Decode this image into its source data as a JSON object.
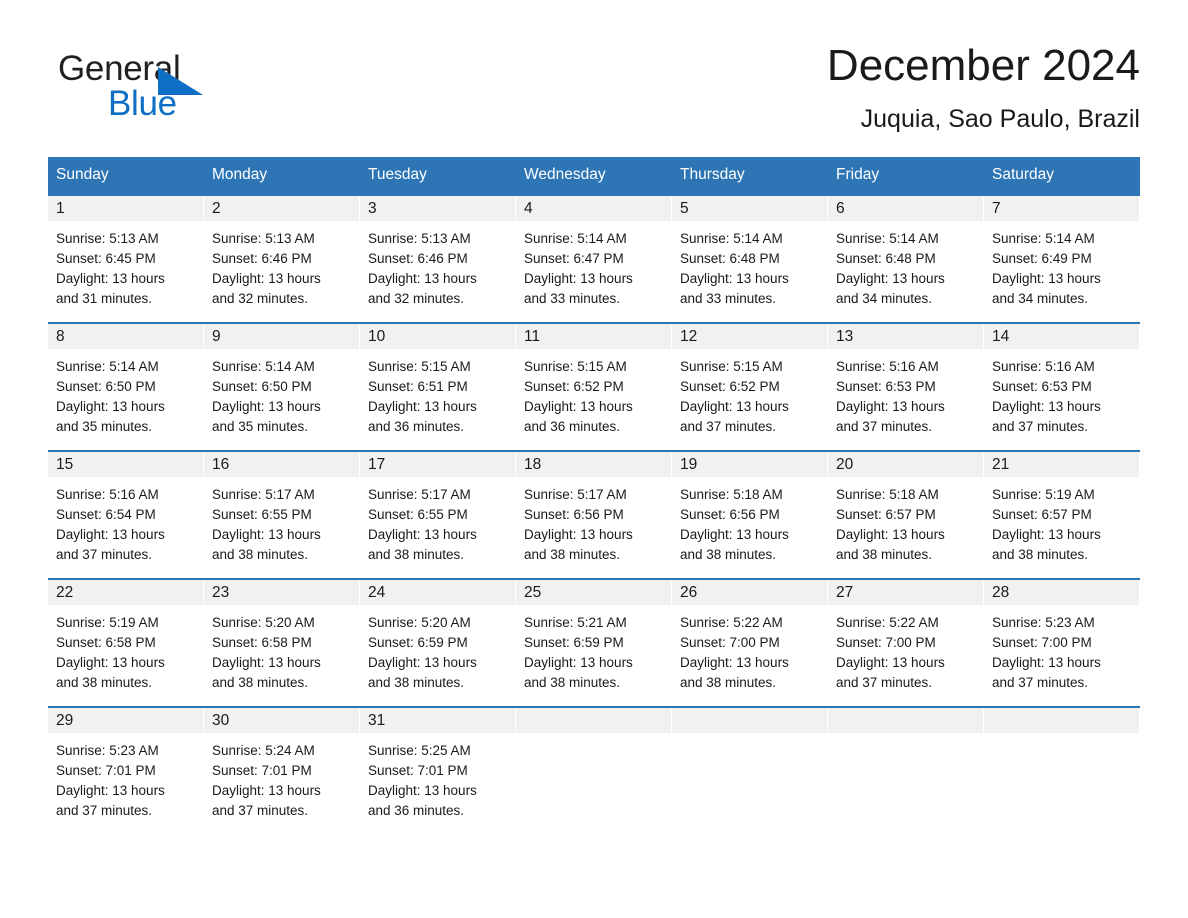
{
  "brand": {
    "name_part1": "General",
    "name_part2": "Blue",
    "triangle_color": "#0f6fc5"
  },
  "header": {
    "title": "December 2024",
    "subtitle": "Juquia, Sao Paulo, Brazil"
  },
  "theme": {
    "header_blue": "#2e75b6",
    "day_band_gray": "#f1f1f1",
    "text_color": "#1a1a1a"
  },
  "weekdays": [
    "Sunday",
    "Monday",
    "Tuesday",
    "Wednesday",
    "Thursday",
    "Friday",
    "Saturday"
  ],
  "weeks": [
    [
      {
        "day": "1",
        "sunrise": "Sunrise: 5:13 AM",
        "sunset": "Sunset: 6:45 PM",
        "daylight1": "Daylight: 13 hours",
        "daylight2": "and 31 minutes."
      },
      {
        "day": "2",
        "sunrise": "Sunrise: 5:13 AM",
        "sunset": "Sunset: 6:46 PM",
        "daylight1": "Daylight: 13 hours",
        "daylight2": "and 32 minutes."
      },
      {
        "day": "3",
        "sunrise": "Sunrise: 5:13 AM",
        "sunset": "Sunset: 6:46 PM",
        "daylight1": "Daylight: 13 hours",
        "daylight2": "and 32 minutes."
      },
      {
        "day": "4",
        "sunrise": "Sunrise: 5:14 AM",
        "sunset": "Sunset: 6:47 PM",
        "daylight1": "Daylight: 13 hours",
        "daylight2": "and 33 minutes."
      },
      {
        "day": "5",
        "sunrise": "Sunrise: 5:14 AM",
        "sunset": "Sunset: 6:48 PM",
        "daylight1": "Daylight: 13 hours",
        "daylight2": "and 33 minutes."
      },
      {
        "day": "6",
        "sunrise": "Sunrise: 5:14 AM",
        "sunset": "Sunset: 6:48 PM",
        "daylight1": "Daylight: 13 hours",
        "daylight2": "and 34 minutes."
      },
      {
        "day": "7",
        "sunrise": "Sunrise: 5:14 AM",
        "sunset": "Sunset: 6:49 PM",
        "daylight1": "Daylight: 13 hours",
        "daylight2": "and 34 minutes."
      }
    ],
    [
      {
        "day": "8",
        "sunrise": "Sunrise: 5:14 AM",
        "sunset": "Sunset: 6:50 PM",
        "daylight1": "Daylight: 13 hours",
        "daylight2": "and 35 minutes."
      },
      {
        "day": "9",
        "sunrise": "Sunrise: 5:14 AM",
        "sunset": "Sunset: 6:50 PM",
        "daylight1": "Daylight: 13 hours",
        "daylight2": "and 35 minutes."
      },
      {
        "day": "10",
        "sunrise": "Sunrise: 5:15 AM",
        "sunset": "Sunset: 6:51 PM",
        "daylight1": "Daylight: 13 hours",
        "daylight2": "and 36 minutes."
      },
      {
        "day": "11",
        "sunrise": "Sunrise: 5:15 AM",
        "sunset": "Sunset: 6:52 PM",
        "daylight1": "Daylight: 13 hours",
        "daylight2": "and 36 minutes."
      },
      {
        "day": "12",
        "sunrise": "Sunrise: 5:15 AM",
        "sunset": "Sunset: 6:52 PM",
        "daylight1": "Daylight: 13 hours",
        "daylight2": "and 37 minutes."
      },
      {
        "day": "13",
        "sunrise": "Sunrise: 5:16 AM",
        "sunset": "Sunset: 6:53 PM",
        "daylight1": "Daylight: 13 hours",
        "daylight2": "and 37 minutes."
      },
      {
        "day": "14",
        "sunrise": "Sunrise: 5:16 AM",
        "sunset": "Sunset: 6:53 PM",
        "daylight1": "Daylight: 13 hours",
        "daylight2": "and 37 minutes."
      }
    ],
    [
      {
        "day": "15",
        "sunrise": "Sunrise: 5:16 AM",
        "sunset": "Sunset: 6:54 PM",
        "daylight1": "Daylight: 13 hours",
        "daylight2": "and 37 minutes."
      },
      {
        "day": "16",
        "sunrise": "Sunrise: 5:17 AM",
        "sunset": "Sunset: 6:55 PM",
        "daylight1": "Daylight: 13 hours",
        "daylight2": "and 38 minutes."
      },
      {
        "day": "17",
        "sunrise": "Sunrise: 5:17 AM",
        "sunset": "Sunset: 6:55 PM",
        "daylight1": "Daylight: 13 hours",
        "daylight2": "and 38 minutes."
      },
      {
        "day": "18",
        "sunrise": "Sunrise: 5:17 AM",
        "sunset": "Sunset: 6:56 PM",
        "daylight1": "Daylight: 13 hours",
        "daylight2": "and 38 minutes."
      },
      {
        "day": "19",
        "sunrise": "Sunrise: 5:18 AM",
        "sunset": "Sunset: 6:56 PM",
        "daylight1": "Daylight: 13 hours",
        "daylight2": "and 38 minutes."
      },
      {
        "day": "20",
        "sunrise": "Sunrise: 5:18 AM",
        "sunset": "Sunset: 6:57 PM",
        "daylight1": "Daylight: 13 hours",
        "daylight2": "and 38 minutes."
      },
      {
        "day": "21",
        "sunrise": "Sunrise: 5:19 AM",
        "sunset": "Sunset: 6:57 PM",
        "daylight1": "Daylight: 13 hours",
        "daylight2": "and 38 minutes."
      }
    ],
    [
      {
        "day": "22",
        "sunrise": "Sunrise: 5:19 AM",
        "sunset": "Sunset: 6:58 PM",
        "daylight1": "Daylight: 13 hours",
        "daylight2": "and 38 minutes."
      },
      {
        "day": "23",
        "sunrise": "Sunrise: 5:20 AM",
        "sunset": "Sunset: 6:58 PM",
        "daylight1": "Daylight: 13 hours",
        "daylight2": "and 38 minutes."
      },
      {
        "day": "24",
        "sunrise": "Sunrise: 5:20 AM",
        "sunset": "Sunset: 6:59 PM",
        "daylight1": "Daylight: 13 hours",
        "daylight2": "and 38 minutes."
      },
      {
        "day": "25",
        "sunrise": "Sunrise: 5:21 AM",
        "sunset": "Sunset: 6:59 PM",
        "daylight1": "Daylight: 13 hours",
        "daylight2": "and 38 minutes."
      },
      {
        "day": "26",
        "sunrise": "Sunrise: 5:22 AM",
        "sunset": "Sunset: 7:00 PM",
        "daylight1": "Daylight: 13 hours",
        "daylight2": "and 38 minutes."
      },
      {
        "day": "27",
        "sunrise": "Sunrise: 5:22 AM",
        "sunset": "Sunset: 7:00 PM",
        "daylight1": "Daylight: 13 hours",
        "daylight2": "and 37 minutes."
      },
      {
        "day": "28",
        "sunrise": "Sunrise: 5:23 AM",
        "sunset": "Sunset: 7:00 PM",
        "daylight1": "Daylight: 13 hours",
        "daylight2": "and 37 minutes."
      }
    ],
    [
      {
        "day": "29",
        "sunrise": "Sunrise: 5:23 AM",
        "sunset": "Sunset: 7:01 PM",
        "daylight1": "Daylight: 13 hours",
        "daylight2": "and 37 minutes."
      },
      {
        "day": "30",
        "sunrise": "Sunrise: 5:24 AM",
        "sunset": "Sunset: 7:01 PM",
        "daylight1": "Daylight: 13 hours",
        "daylight2": "and 37 minutes."
      },
      {
        "day": "31",
        "sunrise": "Sunrise: 5:25 AM",
        "sunset": "Sunset: 7:01 PM",
        "daylight1": "Daylight: 13 hours",
        "daylight2": "and 36 minutes."
      },
      {
        "day": "",
        "sunrise": "",
        "sunset": "",
        "daylight1": "",
        "daylight2": ""
      },
      {
        "day": "",
        "sunrise": "",
        "sunset": "",
        "daylight1": "",
        "daylight2": ""
      },
      {
        "day": "",
        "sunrise": "",
        "sunset": "",
        "daylight1": "",
        "daylight2": ""
      },
      {
        "day": "",
        "sunrise": "",
        "sunset": "",
        "daylight1": "",
        "daylight2": ""
      }
    ]
  ]
}
